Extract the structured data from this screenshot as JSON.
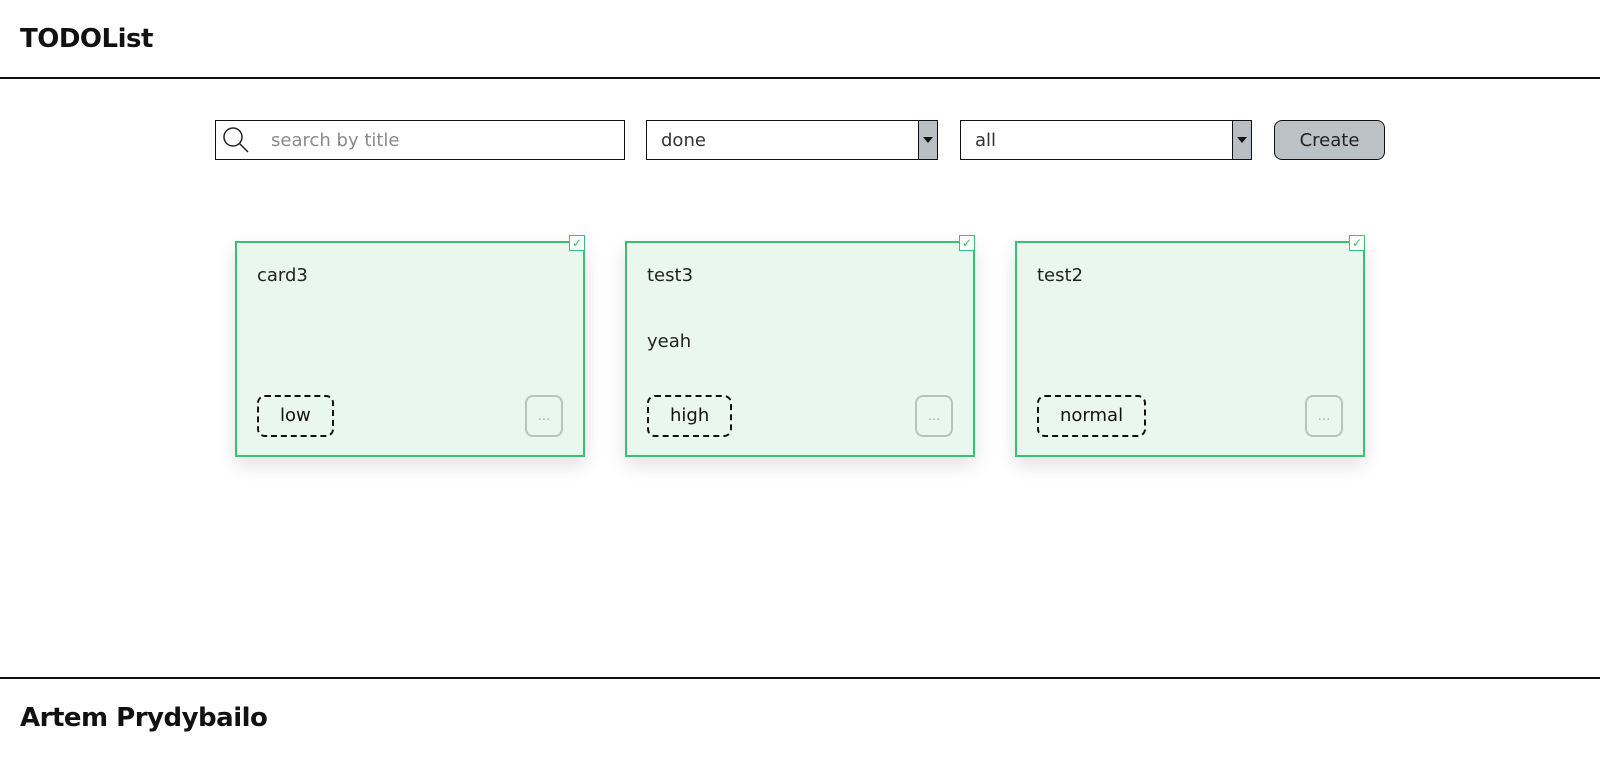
{
  "header": {
    "title": "TODOList"
  },
  "toolbar": {
    "search": {
      "placeholder": "search by title",
      "value": "",
      "icon": "search-icon"
    },
    "status_filter": {
      "selected": "done"
    },
    "priority_filter": {
      "selected": "all"
    },
    "create_label": "Create"
  },
  "cards": [
    {
      "title": "card3",
      "description": "",
      "priority": "low",
      "done": true,
      "more_label": "..."
    },
    {
      "title": "test3",
      "description": "yeah",
      "priority": "high",
      "done": true,
      "more_label": "..."
    },
    {
      "title": "test2",
      "description": "",
      "priority": "normal",
      "done": true,
      "more_label": "..."
    }
  ],
  "footer": {
    "author": "Artem Prydybailo"
  },
  "colors": {
    "card_border": "#38c172",
    "card_background": "#eaf7ef",
    "dropdown_arrow_bg": "#b8bec4",
    "create_button_bg": "#bcc1c6"
  }
}
